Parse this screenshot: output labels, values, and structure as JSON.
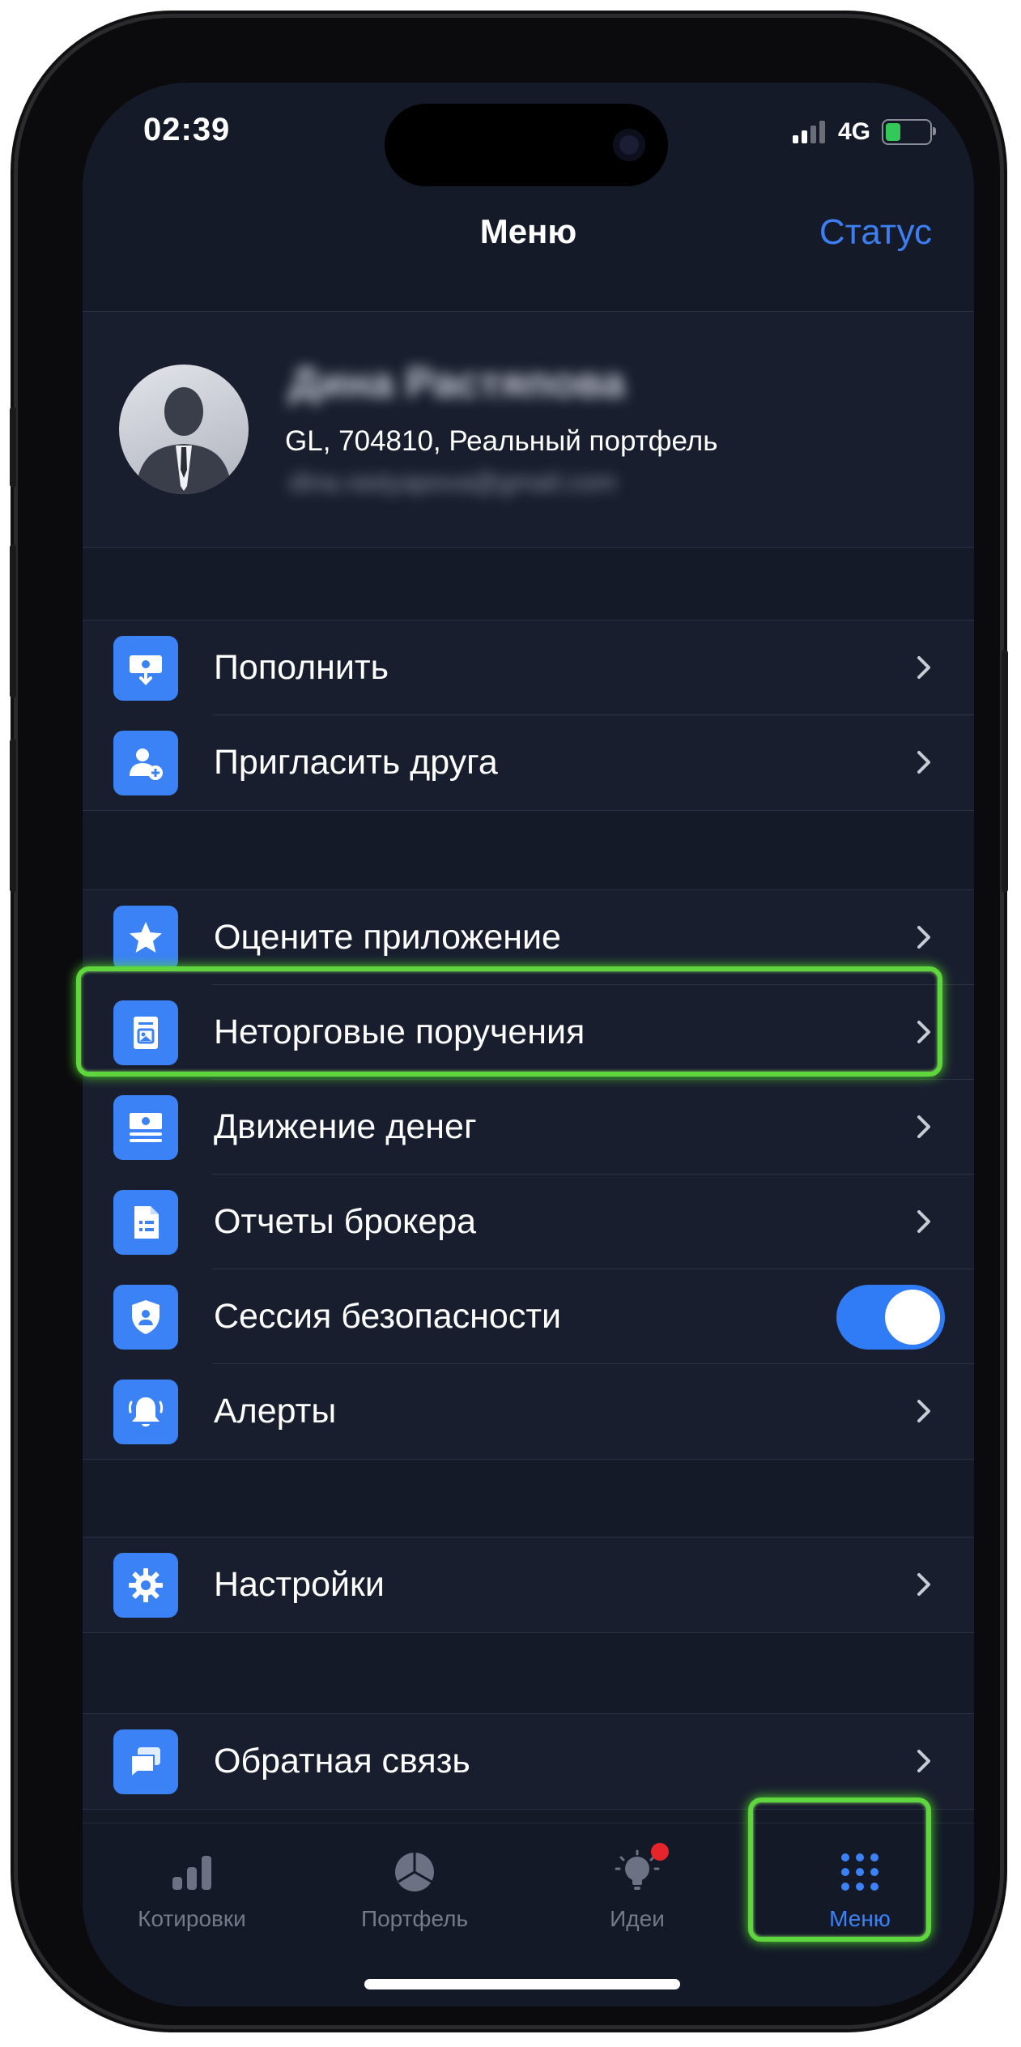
{
  "status_bar": {
    "time": "02:39",
    "network": "4G"
  },
  "nav": {
    "title": "Меню",
    "status_link": "Статус"
  },
  "profile": {
    "name": "Дина Растяпова",
    "account": "GL, 704810, Реальный портфель",
    "email": "dina.rastyapova@gmail.com"
  },
  "group1": [
    {
      "label": "Пополнить",
      "icon": "deposit-icon"
    },
    {
      "label": "Пригласить друга",
      "icon": "invite-friend-icon"
    }
  ],
  "group2": [
    {
      "label": "Оцените приложение",
      "icon": "star-icon"
    },
    {
      "label": "Неторговые поручения",
      "icon": "document-icon"
    },
    {
      "label": "Движение денег",
      "icon": "cash-flow-icon"
    },
    {
      "label": "Отчеты брокера",
      "icon": "report-icon"
    },
    {
      "label": "Сессия безопасности",
      "icon": "shield-icon",
      "toggle_on": true
    },
    {
      "label": "Алерты",
      "icon": "bell-icon"
    }
  ],
  "group3": [
    {
      "label": "Настройки",
      "icon": "gear-icon"
    }
  ],
  "group4": [
    {
      "label": "Обратная связь",
      "icon": "chat-icon"
    }
  ],
  "tabs": [
    {
      "label": "Котировки",
      "icon": "bar-chart-icon",
      "active": false
    },
    {
      "label": "Портфель",
      "icon": "pie-chart-icon",
      "active": false
    },
    {
      "label": "Идеи",
      "icon": "lightbulb-icon",
      "active": false,
      "badge": true
    },
    {
      "label": "Меню",
      "icon": "grid-icon",
      "active": true
    }
  ],
  "colors": {
    "accent": "#3b82f6",
    "highlight": "#5fd63d",
    "background": "#151a28",
    "row_bg": "#191e2e"
  }
}
